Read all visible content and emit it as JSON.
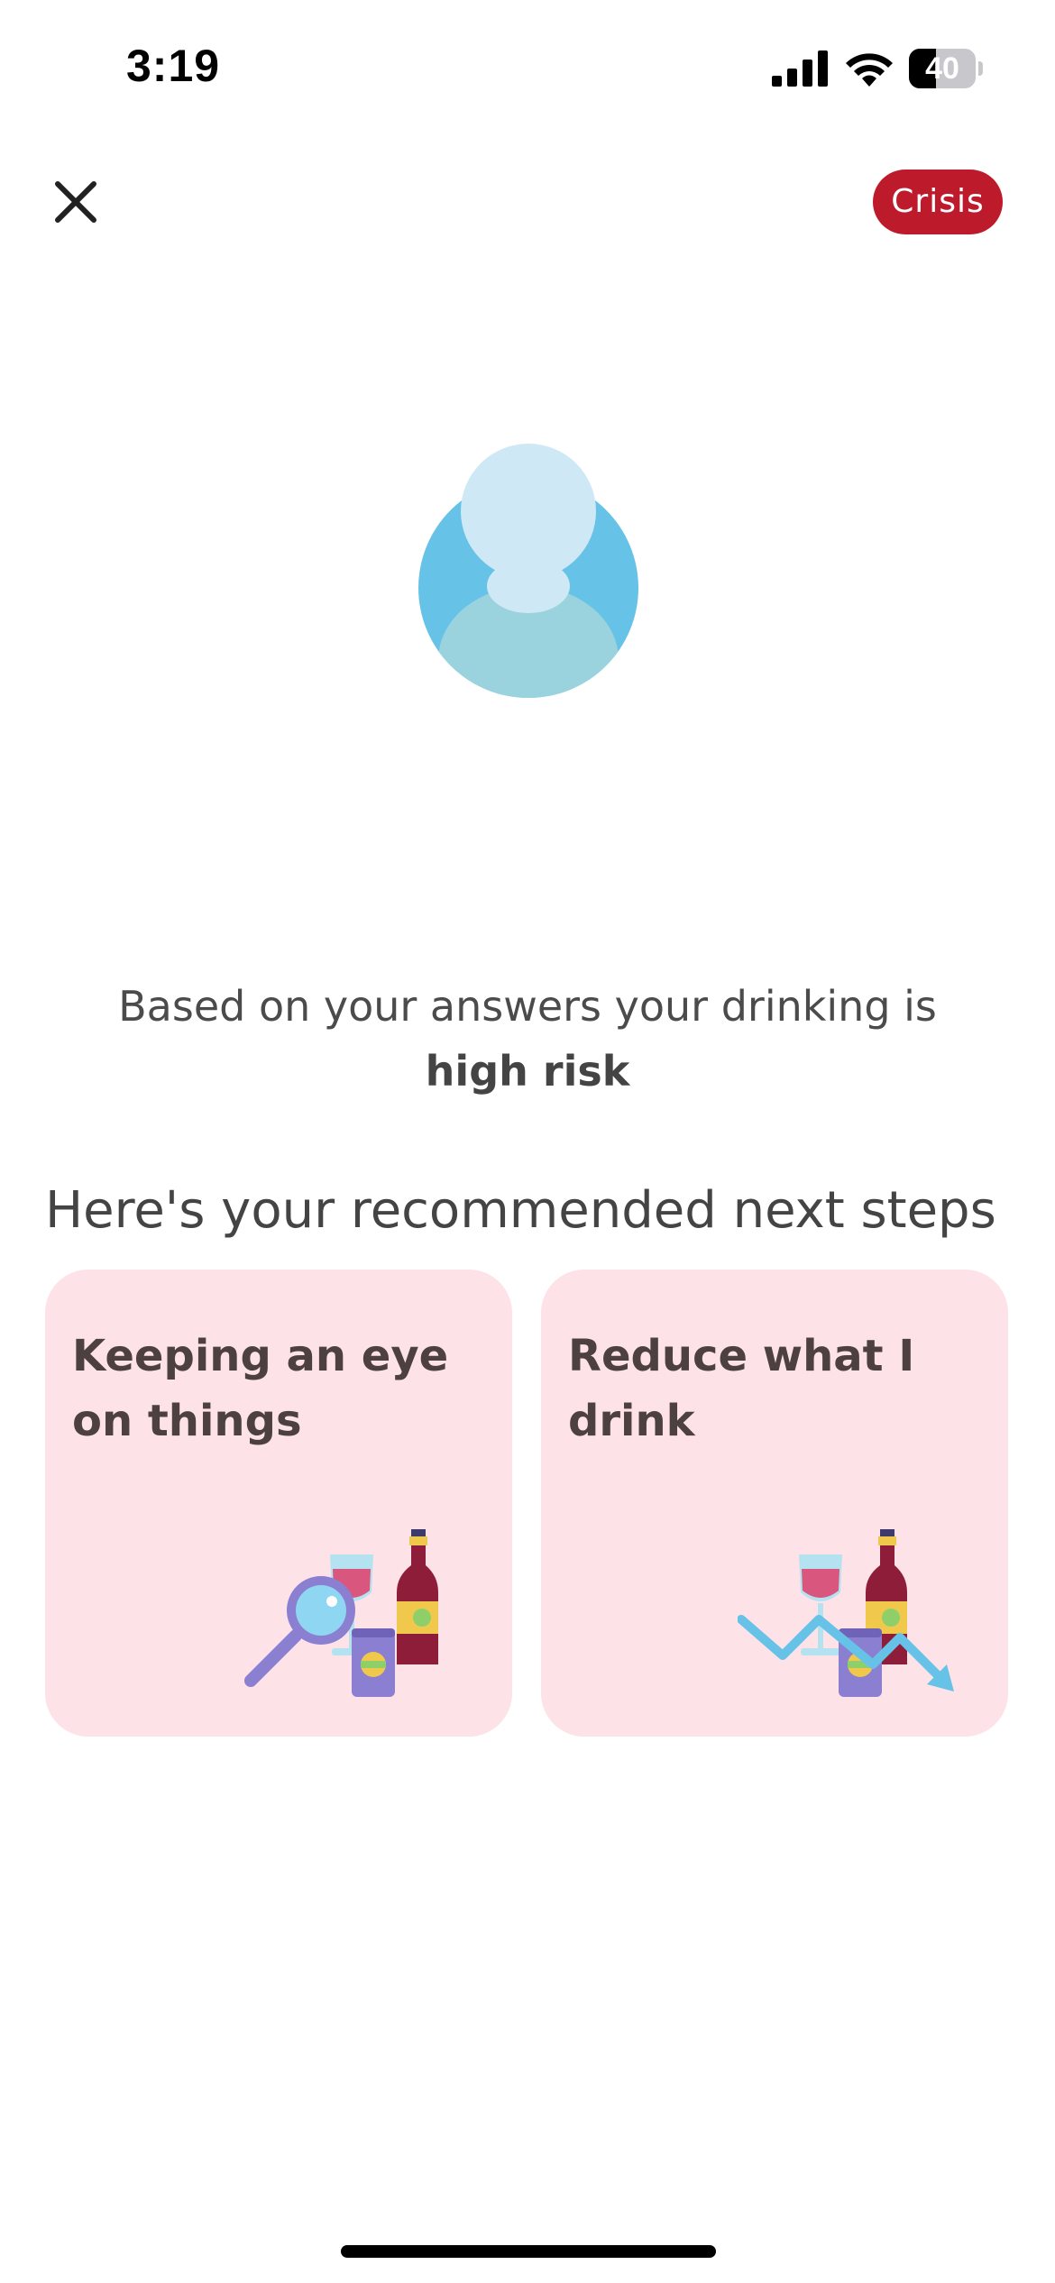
{
  "status_bar": {
    "time": "3:19",
    "battery": "40",
    "battery_level_percent": 40
  },
  "header": {
    "close_icon": "close-icon",
    "crisis_label": "Crisis",
    "crisis_color": "#bd1a2c"
  },
  "avatar": {
    "icon": "user-avatar-icon",
    "colors": {
      "outer": "#67c2e8",
      "head": "#cfe8f5",
      "body": "#9ad3de"
    }
  },
  "result": {
    "prefix": "Based on your answers your drinking is",
    "level": "high risk"
  },
  "next_steps": {
    "heading": "Here's your recommended next steps",
    "cards": [
      {
        "title": "Keeping an eye on things",
        "icon": "drinks-magnifier-icon"
      },
      {
        "title": "Reduce what I drink",
        "icon": "drinks-trend-down-icon"
      }
    ],
    "card_color": "#fde2e7"
  }
}
